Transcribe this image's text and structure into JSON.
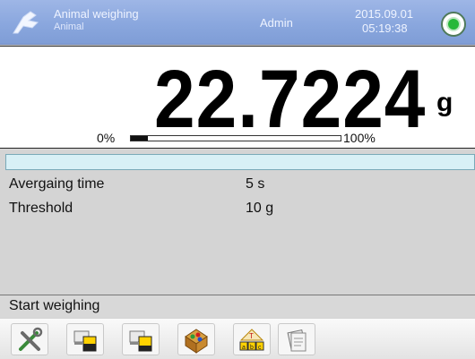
{
  "topbar": {
    "mode": "Animal weighing",
    "mode_sub": "Animal",
    "user": "Admin",
    "date": "2015.09.01",
    "time": "05:19:38"
  },
  "display": {
    "value": "22.7224",
    "unit": "g",
    "range_min_label": "0%",
    "range_max_label": "100%",
    "range_fill_fraction": 0.08
  },
  "info": {
    "rows": [
      {
        "label": "Avergaing time",
        "value": "5 s"
      },
      {
        "label": "Threshold",
        "value": "10 g"
      }
    ]
  },
  "function_bar": {
    "label": "Start weighing"
  },
  "toolbar": {
    "buttons": [
      {
        "icon": "settings-tools-icon"
      },
      {
        "icon": "tare-icon"
      },
      {
        "icon": "zero-icon"
      },
      {
        "icon": "product-database-icon"
      },
      {
        "icon": "print-abc-icon"
      },
      {
        "icon": "report-icon"
      }
    ]
  },
  "colors": {
    "topbar": "#8aa7de",
    "status_green": "#27b83a",
    "info_strip": "#d8f0f6"
  }
}
